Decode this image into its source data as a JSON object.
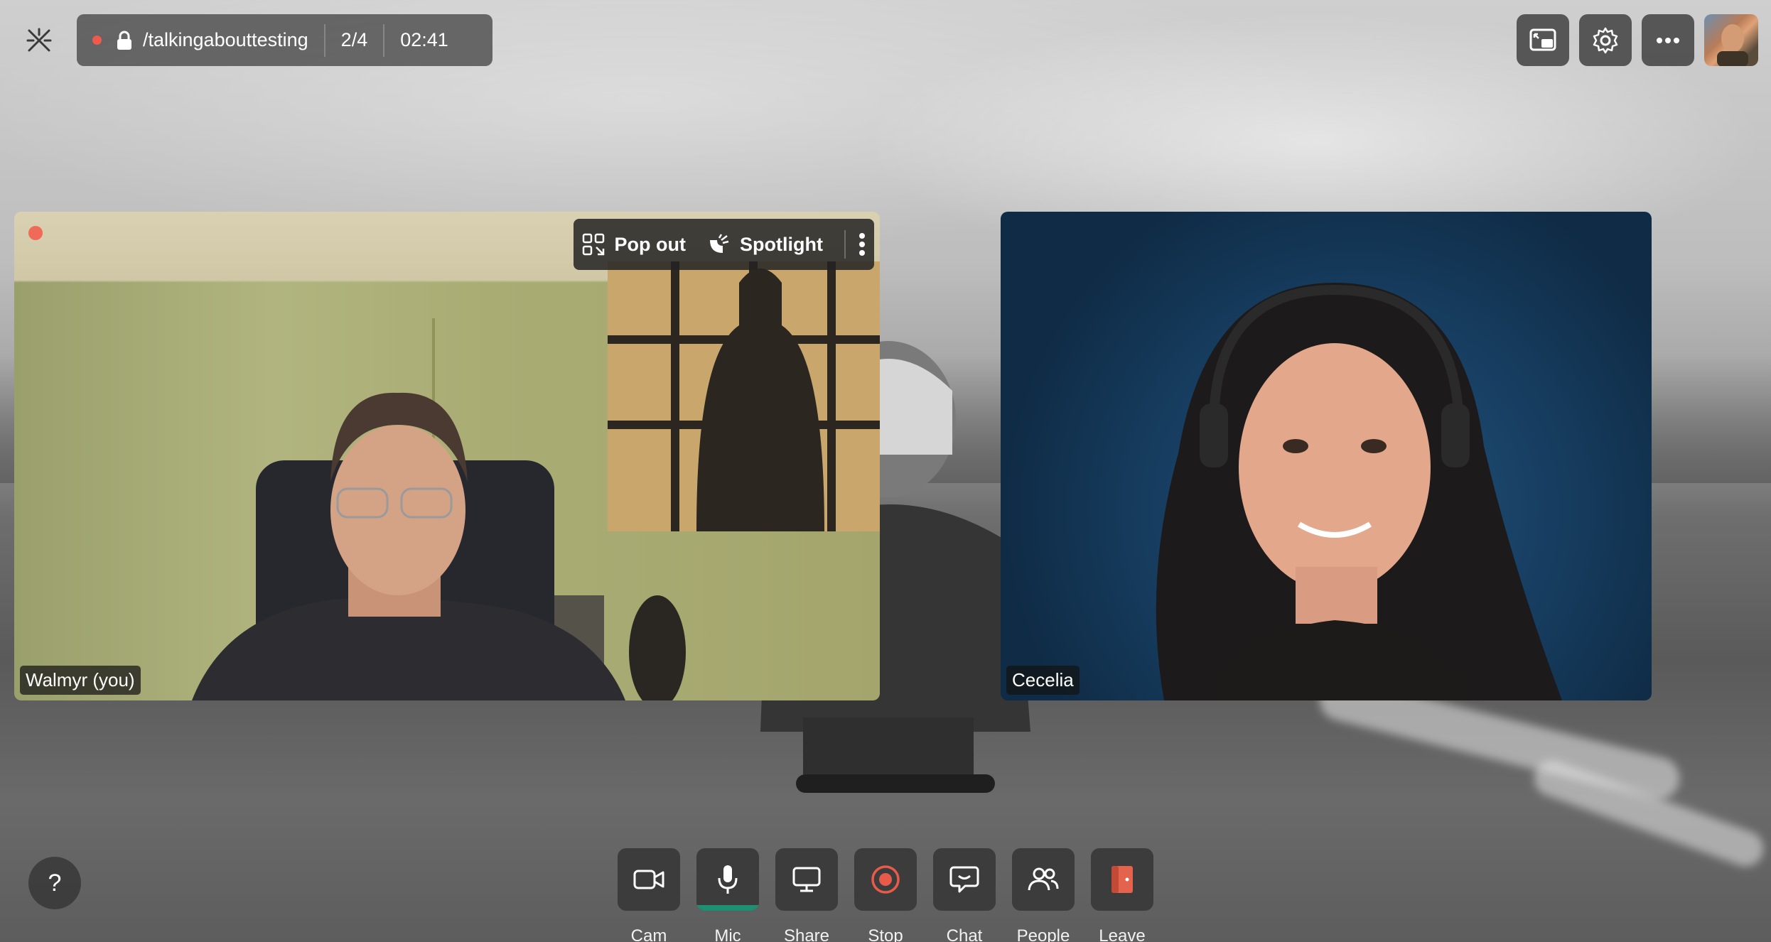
{
  "room": {
    "path": "/talkingabouttesting",
    "participants": "2/4",
    "timer": "02:41"
  },
  "participants": [
    {
      "name": "Walmyr (you)"
    },
    {
      "name": "Cecelia"
    }
  ],
  "tile_toolbar": {
    "pop_out": "Pop out",
    "spotlight": "Spotlight"
  },
  "controls": [
    {
      "label": "Cam",
      "icon": "camera-icon"
    },
    {
      "label": "Mic",
      "icon": "microphone-icon"
    },
    {
      "label": "Share",
      "icon": "monitor-icon"
    },
    {
      "label": "Stop",
      "icon": "record-stop-icon"
    },
    {
      "label": "Chat",
      "icon": "chat-icon"
    },
    {
      "label": "People",
      "icon": "people-icon"
    },
    {
      "label": "Leave",
      "icon": "door-exit-icon"
    }
  ],
  "help": {
    "label": "?"
  },
  "colors": {
    "record_red": "#ee5a4c",
    "mic_active": "#1f8f72",
    "leave_orange": "#e3634d",
    "bar_bg": "#464646"
  }
}
